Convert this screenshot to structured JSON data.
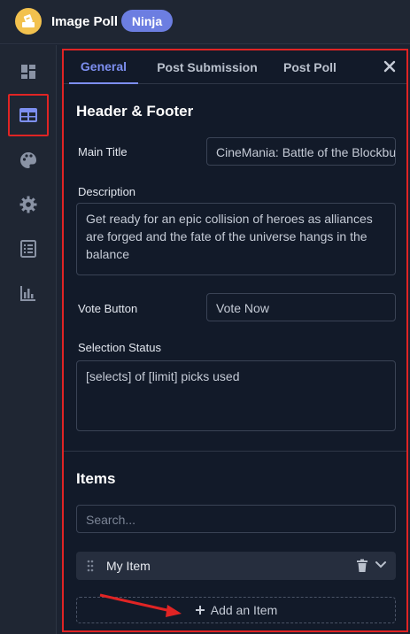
{
  "app": {
    "title": "Image Poll",
    "badge": "Ninja"
  },
  "sidebar": {
    "items": [
      {
        "icon": "dashboard-icon"
      },
      {
        "icon": "table-grid-icon",
        "active": true
      },
      {
        "icon": "palette-icon"
      },
      {
        "icon": "gear-icon"
      },
      {
        "icon": "form-list-icon"
      },
      {
        "icon": "bar-chart-icon"
      }
    ]
  },
  "tabs": [
    {
      "label": "General",
      "active": true
    },
    {
      "label": "Post Submission"
    },
    {
      "label": "Post Poll"
    }
  ],
  "header_footer": {
    "title": "Header & Footer",
    "main_title_label": "Main Title",
    "main_title_value": "CineMania: Battle of the Blockbusters",
    "description_label": "Description",
    "description_value": "Get ready for an epic collision of heroes as alliances are forged and the fate of the universe hangs in the balance",
    "vote_button_label": "Vote Button",
    "vote_button_value": "Vote Now",
    "selection_status_label": "Selection Status",
    "selection_status_value": "[selects] of [limit] picks used"
  },
  "items_section": {
    "title": "Items",
    "search_placeholder": "Search...",
    "items": [
      {
        "label": "My Item"
      }
    ],
    "add_label": "Add an Item"
  },
  "colors": {
    "accent": "#7d8ff0",
    "highlight_border": "#e02424",
    "badge": "#6c7ee1"
  }
}
